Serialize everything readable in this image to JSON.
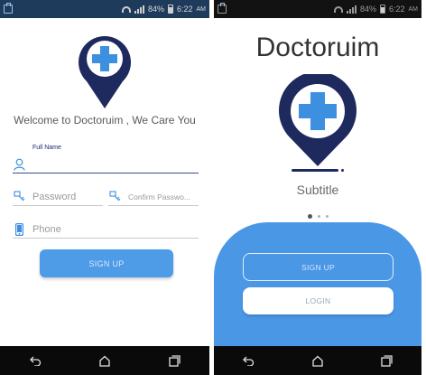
{
  "status_bar": {
    "battery": "84%",
    "time": "6:22",
    "ampm": "AM"
  },
  "colors": {
    "brand_navy": "#1e2a5e",
    "accent_blue": "#4a97e6",
    "cross_blue": "#3d8fe0"
  },
  "signup_screen": {
    "welcome": "Welcome to Doctoruim , We Care You",
    "full_name_label": "Full Name",
    "password_placeholder": "Password",
    "confirm_password_placeholder": "Confirm Passwo...",
    "phone_placeholder": "Phone",
    "signup_button": "SIGN UP",
    "icons": [
      "logo-pin-icon",
      "user-icon",
      "key-icon",
      "key-icon",
      "phone-icon"
    ]
  },
  "landing_screen": {
    "app_title": "Doctoruim",
    "subtitle": "Subtitle",
    "page_indicator": {
      "count": 3,
      "active": 1
    },
    "signup_button": "SIGN UP",
    "login_button": "LOGIN"
  },
  "nav_bar": {
    "icons": [
      "back-icon",
      "home-icon",
      "recents-icon"
    ]
  }
}
